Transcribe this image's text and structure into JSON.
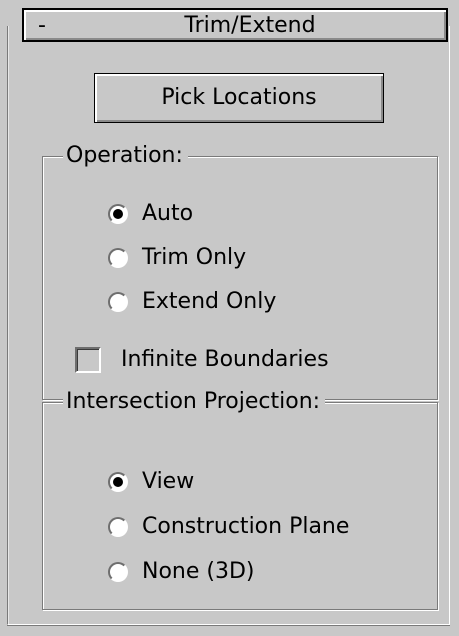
{
  "rollout": {
    "collapse_symbol": "-",
    "title": "Trim/Extend"
  },
  "pick_locations": {
    "label": "Pick Locations"
  },
  "operation": {
    "legend": "Operation:",
    "options": [
      {
        "label": "Auto",
        "checked": true
      },
      {
        "label": "Trim Only",
        "checked": false
      },
      {
        "label": "Extend Only",
        "checked": false
      }
    ],
    "infinite_boundaries": {
      "label": "Infinite Boundaries",
      "checked": false
    }
  },
  "intersection_projection": {
    "legend": "Intersection Projection:",
    "options": [
      {
        "label": "View",
        "checked": true
      },
      {
        "label": "Construction Plane",
        "checked": false
      },
      {
        "label": "None (3D)",
        "checked": false
      }
    ]
  }
}
